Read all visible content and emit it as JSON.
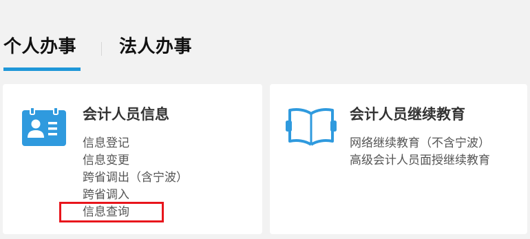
{
  "tabs": {
    "personal": "个人办事",
    "corporate": "法人办事"
  },
  "cards": [
    {
      "title": "会计人员信息",
      "icon": "id-card-icon",
      "links": [
        "信息登记",
        "信息变更",
        "跨省调出（含宁波）",
        "跨省调入",
        "信息查询"
      ]
    },
    {
      "title": "会计人员继续教育",
      "icon": "open-book-icon",
      "links": [
        "网络继续教育（不含宁波）",
        "高级会计人员面授继续教育"
      ]
    }
  ],
  "colors": {
    "accent": "#1f97d8",
    "highlight": "#e8151c",
    "background": "#f2f2f2"
  }
}
